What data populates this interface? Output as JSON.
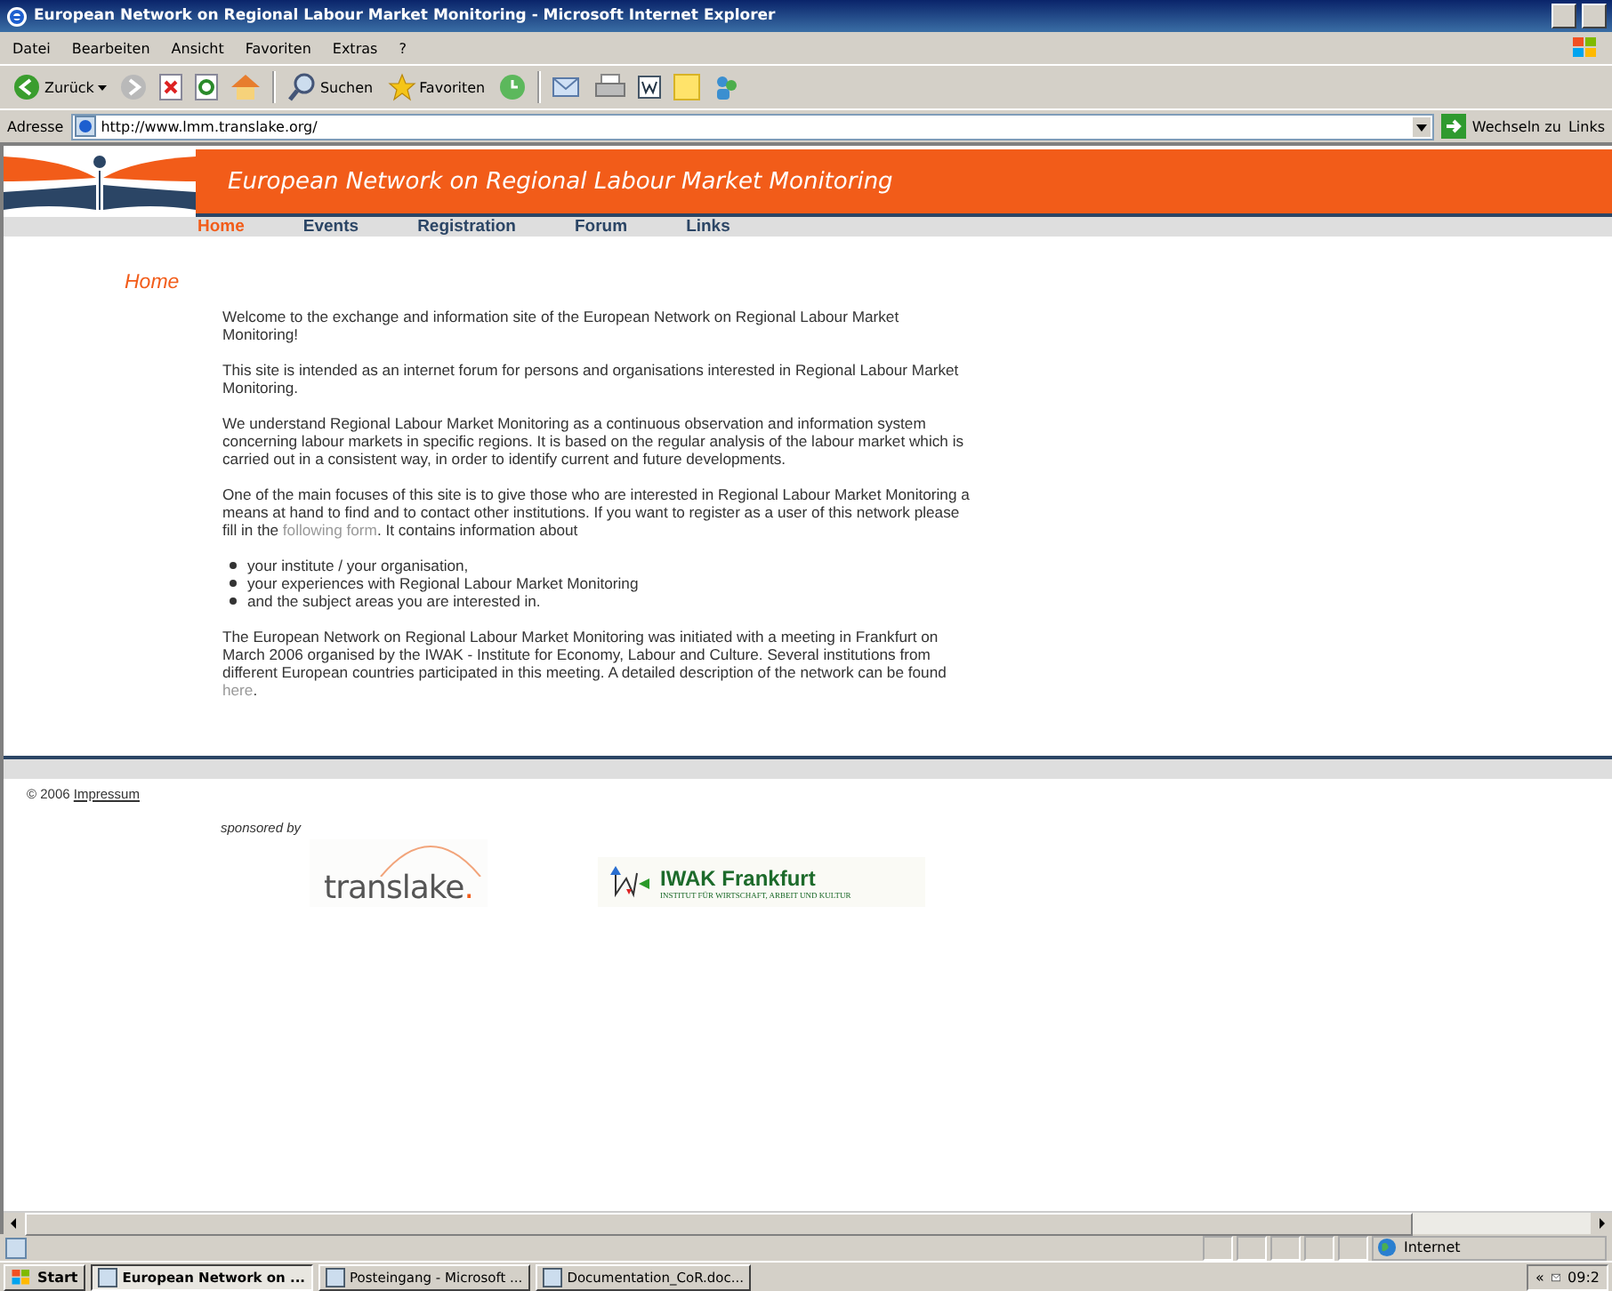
{
  "window": {
    "title": "European Network on Regional Labour Market Monitoring - Microsoft Internet Explorer"
  },
  "menu": [
    "Datei",
    "Bearbeiten",
    "Ansicht",
    "Favoriten",
    "Extras",
    "?"
  ],
  "toolbar": {
    "back": "Zurück",
    "search": "Suchen",
    "favorites": "Favoriten"
  },
  "address": {
    "label": "Adresse",
    "value": "http://www.lmm.translake.org/",
    "go": "Wechseln zu",
    "links": "Links"
  },
  "page": {
    "banner_title": "European Network on Regional Labour Market Monitoring",
    "nav": [
      {
        "label": "Home",
        "selected": true
      },
      {
        "label": "Events",
        "selected": false
      },
      {
        "label": "Registration",
        "selected": false
      },
      {
        "label": "Forum",
        "selected": false
      },
      {
        "label": "Links",
        "selected": false
      }
    ],
    "heading": "Home",
    "paragraphs": [
      {
        "text": "Welcome to the exchange and information site of the European Network on Regional Labour Market Monitoring!"
      },
      {
        "text": "This site is intended as an internet forum for persons and organisations interested in Regional Labour Market Monitoring."
      },
      {
        "text": "We understand Regional Labour Market Monitoring as a continuous observation and information system concerning labour markets in specific regions. It is based on the regular analysis of the labour market which is carried out in a consistent way, in order to identify current and future developments."
      },
      {
        "text": "One of the main focuses of this site is to give those who are interested in Regional Labour Market Monitoring a means at hand to find and to contact other institutions. If you want to register as a user of this network please fill in the ",
        "link": "following form",
        "after": ". It contains information about"
      }
    ],
    "bullets": [
      "your institute / your organisation,",
      "your experiences with Regional Labour Market Monitoring",
      "and the subject areas you are interested in."
    ],
    "closing": {
      "text": "The European Network on Regional Labour Market Monitoring was initiated with a meeting in Frankfurt on March 2006 organised by the IWAK - Institute for Economy, Labour and Culture. Several institutions from different European countries participated in this meeting. A detailed description of the network can be found ",
      "link": "here",
      "after": "."
    },
    "copyright": "© 2006",
    "impressum": "Impressum",
    "sponsored": "sponsored by",
    "translake": "translake",
    "translake_dot": ".",
    "iwak": "IWAK Frankfurt",
    "iwak_sub": "INSTITUT FÜR WIRTSCHAFT, ARBEIT UND KULTUR"
  },
  "status_bar": {
    "zone": "Internet"
  },
  "taskbar": {
    "start": "Start",
    "tasks": [
      {
        "label": "European Network on ...",
        "selected": true
      },
      {
        "label": "Posteingang - Microsoft ...",
        "selected": false
      },
      {
        "label": "Documentation_CoR.doc...",
        "selected": false
      }
    ],
    "expand": "«",
    "clock": "09:2"
  }
}
